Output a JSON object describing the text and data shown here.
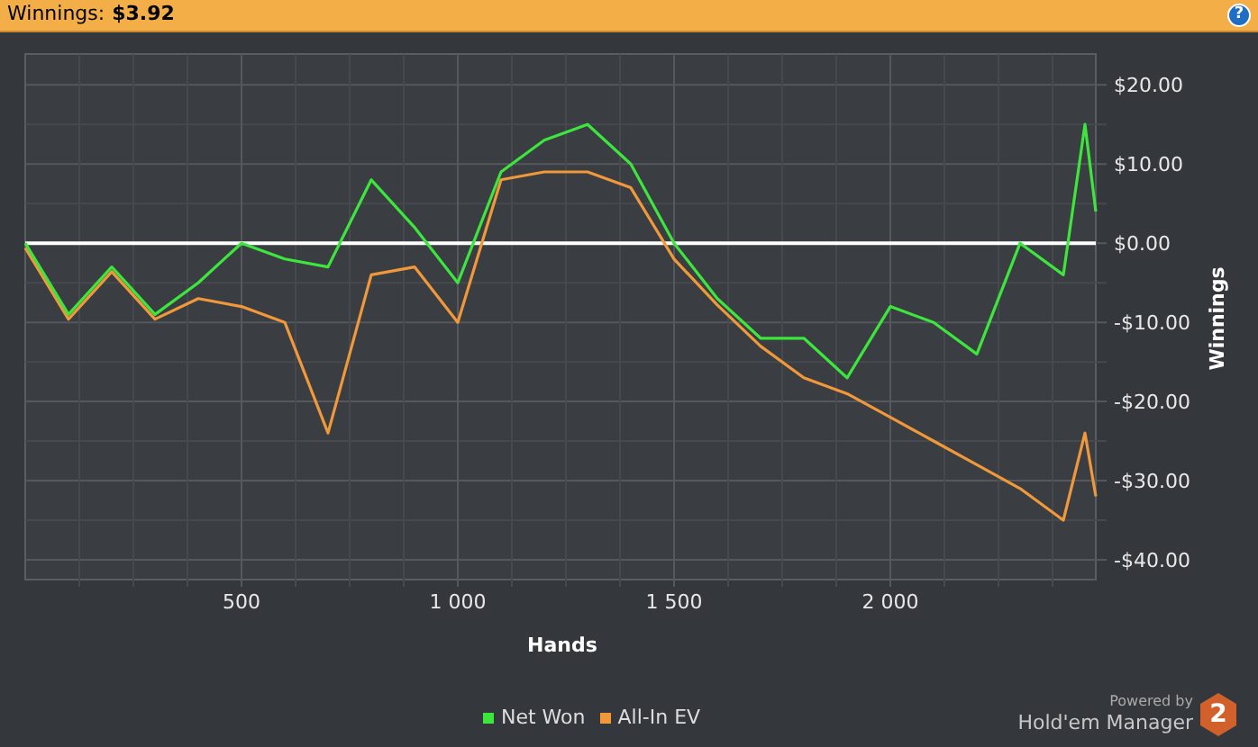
{
  "header": {
    "label": "Winnings:",
    "value": "$3.92",
    "help": "?"
  },
  "chart": {
    "chart_data": {
      "type": "line",
      "xlabel": "Hands",
      "ylabel": "Winnings",
      "x": [
        0,
        100,
        200,
        300,
        400,
        500,
        600,
        700,
        800,
        900,
        1000,
        1100,
        1200,
        1300,
        1400,
        1500,
        1600,
        1700,
        1800,
        1900,
        2000,
        2100,
        2200,
        2300,
        2400,
        2450,
        2475
      ],
      "series": [
        {
          "name": "Net Won",
          "color": "#3de63d",
          "values": [
            0,
            -9,
            -3,
            -9,
            -5,
            0,
            -2,
            -3,
            8,
            2,
            -5,
            9,
            13,
            15,
            10,
            0,
            -7,
            -12,
            -12,
            -17,
            -8,
            -10,
            -14,
            0,
            -4,
            15,
            4
          ]
        },
        {
          "name": "All-In EV",
          "color": "#f0983a",
          "values": [
            -0.6,
            -9.6,
            -3.6,
            -9.6,
            -7,
            -8,
            -10,
            -24,
            -4,
            -3,
            -10,
            8,
            9,
            9,
            7,
            -2,
            -7.8,
            -13,
            -17,
            -19,
            -22,
            -25,
            -28,
            -31,
            -35,
            -24,
            -32
          ]
        }
      ],
      "grid": true,
      "xlim": [
        0,
        2475
      ],
      "ylim": [
        -42.5,
        23.9
      ],
      "xticks": [
        {
          "value": 500,
          "label": "500"
        },
        {
          "value": 1000,
          "label": "1 000"
        },
        {
          "value": 1500,
          "label": "1 500"
        },
        {
          "value": 2000,
          "label": "2 000"
        }
      ],
      "yticks": [
        {
          "value": 20,
          "label": "$20.00"
        },
        {
          "value": 10,
          "label": "$10.00"
        },
        {
          "value": 0,
          "label": "$0.00"
        },
        {
          "value": -10,
          "label": "-$10.00"
        },
        {
          "value": -20,
          "label": "-$20.00"
        },
        {
          "value": -30,
          "label": "-$30.00"
        },
        {
          "value": -40,
          "label": "-$40.00"
        }
      ]
    }
  },
  "branding": {
    "caption": "Powered by",
    "product": "Hold'em Manager",
    "badge": "2"
  }
}
